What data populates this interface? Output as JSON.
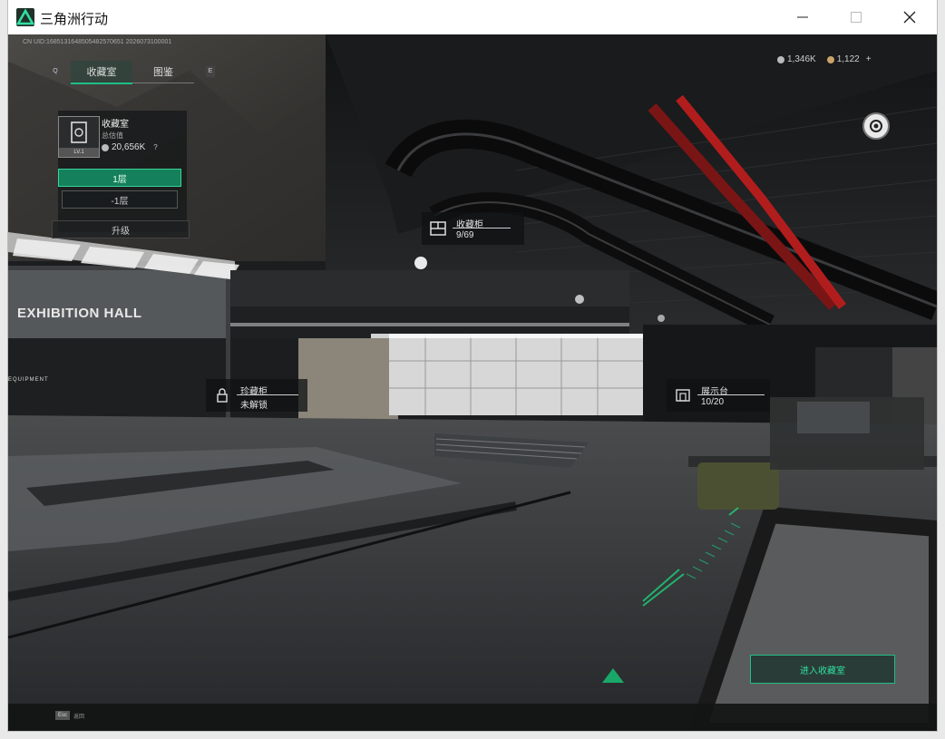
{
  "window": {
    "title": "三角洲行动",
    "buttons": {
      "minimize": "—",
      "maximize": "☐",
      "close": "✕"
    }
  },
  "hud": {
    "uid": "CN UID:1685131648505482570651 2026073100001",
    "currency": [
      {
        "icon": "coin-icon",
        "value": "1,346K"
      },
      {
        "icon": "coin-icon",
        "value": "1,122"
      }
    ],
    "currency_add": "+",
    "tabs": [
      {
        "label": "收藏室"
      },
      {
        "label": "图鉴"
      }
    ],
    "prev_tab_key": "Q",
    "next_tab_key": "E",
    "room": {
      "name": "收藏室",
      "value_label": "总估值",
      "value": "20,656K",
      "help": "?",
      "level": "LV.1"
    },
    "floors": [
      {
        "label": "1层"
      },
      {
        "label": "-1层"
      }
    ],
    "upgrade_label": "升级",
    "enter_button": "进入收藏室",
    "back_key": "Esc",
    "back_label": "返回"
  },
  "markers": {
    "cabinet": {
      "title": "收藏柜",
      "value": "9/69"
    },
    "treasure": {
      "title": "珍藏柜",
      "value": "未解锁"
    },
    "display": {
      "title": "展示台",
      "value": "10/20"
    }
  },
  "scene": {
    "sign": "EXHIBITION HALL",
    "sign_small": "EQUIPMENT"
  },
  "colors": {
    "accent": "#1fbf86",
    "titlebar": "#ffffff",
    "pipe": "#b11d1d"
  }
}
